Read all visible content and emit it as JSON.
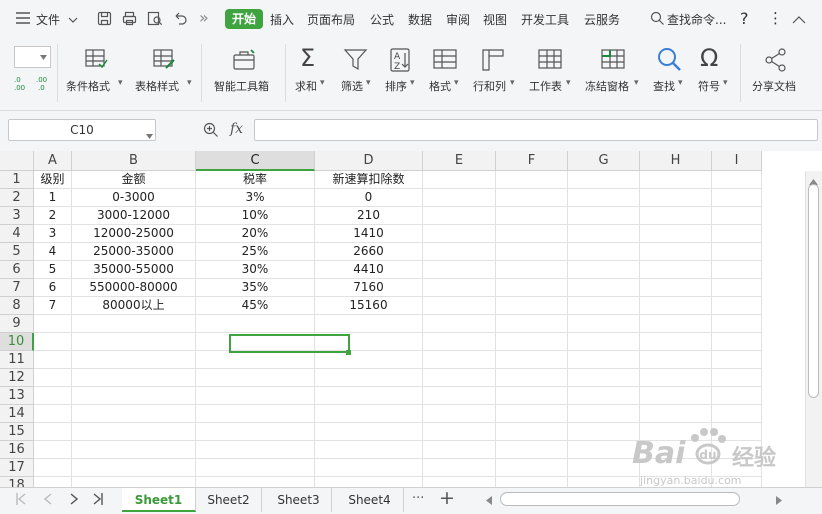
{
  "menubar": {
    "file_label": "文件",
    "more_glyph": "»",
    "tabs": [
      "开始",
      "插入",
      "页面布局",
      "公式",
      "数据",
      "审阅",
      "视图",
      "开发工具",
      "云服务"
    ],
    "search_label": "查找命令...",
    "help_glyph": "?",
    "more_menu_glyph": "⋮",
    "collapse_glyph": "︿"
  },
  "ribbon": {
    "buttons": [
      {
        "label": "条件格式",
        "icon": "conditional-format-icon"
      },
      {
        "label": "表格样式",
        "icon": "table-style-icon"
      },
      {
        "label": "智能工具箱",
        "icon": "toolbox-icon"
      },
      {
        "label": "求和",
        "icon": "sum-icon"
      },
      {
        "label": "筛选",
        "icon": "filter-icon"
      },
      {
        "label": "排序",
        "icon": "sort-icon"
      },
      {
        "label": "格式",
        "icon": "format-icon"
      },
      {
        "label": "行和列",
        "icon": "rows-columns-icon"
      },
      {
        "label": "工作表",
        "icon": "worksheet-icon"
      },
      {
        "label": "冻结窗格",
        "icon": "freeze-panes-icon"
      },
      {
        "label": "查找",
        "icon": "find-icon"
      },
      {
        "label": "符号",
        "icon": "symbol-icon"
      },
      {
        "label": "分享文档",
        "icon": "share-icon"
      }
    ],
    "dropdown_glyph": "▾",
    "sum_glyph": "Σ",
    "symbol_glyph": "Ω"
  },
  "formula_bar": {
    "name_box": "C10",
    "fx_label": "fx",
    "formula_value": ""
  },
  "grid": {
    "columns": [
      "A",
      "B",
      "C",
      "D",
      "E",
      "F",
      "G",
      "H",
      "I"
    ],
    "row_numbers": [
      "1",
      "2",
      "3",
      "4",
      "5",
      "6",
      "7",
      "8",
      "9",
      "10",
      "11",
      "12",
      "13",
      "14",
      "15",
      "16",
      "17",
      "18"
    ],
    "rows": [
      [
        "级别",
        "金额",
        "税率",
        "新速算扣除数"
      ],
      [
        "1",
        "0-3000",
        "3%",
        "0"
      ],
      [
        "2",
        "3000-12000",
        "10%",
        "210"
      ],
      [
        "3",
        "12000-25000",
        "20%",
        "1410"
      ],
      [
        "4",
        "25000-35000",
        "25%",
        "2660"
      ],
      [
        "5",
        "35000-55000",
        "30%",
        "4410"
      ],
      [
        "6",
        "550000-80000",
        "35%",
        "7160"
      ],
      [
        "7",
        "80000以上",
        "45%",
        "15160"
      ]
    ],
    "selected_cell": "C10"
  },
  "sheetbar": {
    "tabs": [
      "Sheet1",
      "Sheet2",
      "Sheet3",
      "Sheet4"
    ],
    "active": "Sheet1",
    "more_glyph": "···",
    "add_glyph": "+"
  },
  "watermark": {
    "brand": "Bai",
    "brand_cn": "经验",
    "url": "jingyan.baidu.com"
  },
  "colors": {
    "accent": "#3fa33f",
    "toolbar_bg": "#f4f5f7"
  }
}
